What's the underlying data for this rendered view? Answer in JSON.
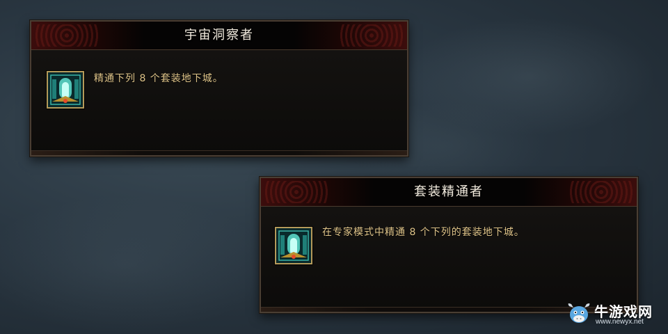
{
  "achievements": [
    {
      "title": "宇宙洞察者",
      "description": "精通下列 8 个套装地下城。",
      "icon": "dungeon-portal-icon"
    },
    {
      "title": "套装精通者",
      "description": "在专家模式中精通 8 个下列的套装地下城。",
      "icon": "dungeon-portal-icon"
    }
  ],
  "watermark": {
    "site_name": "牛游戏网",
    "site_url": "www.newyx.net",
    "icon": "bull-mascot-icon"
  },
  "colors": {
    "title_text": "#f4ede0",
    "description_text": "#e0c58a",
    "frame_red": "#3c0d0c",
    "icon_border": "#b59a5a"
  }
}
